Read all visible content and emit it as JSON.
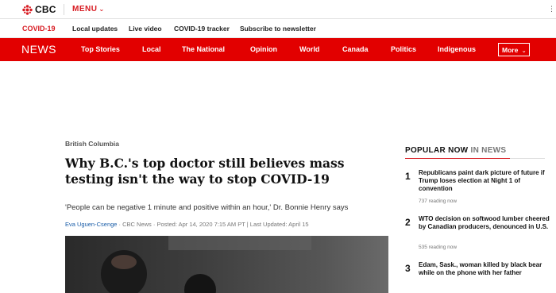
{
  "header": {
    "logo_text": "CBC",
    "menu_label": "MENU"
  },
  "covid_bar": {
    "label": "COVID-19",
    "links": [
      "Local updates",
      "Live video",
      "COVID-19 tracker",
      "Subscribe to newsletter"
    ]
  },
  "news_bar": {
    "brand": "NEWS",
    "nav": [
      "Top Stories",
      "Local",
      "The National",
      "Opinion",
      "World",
      "Canada",
      "Politics",
      "Indigenous"
    ],
    "more_label": "More"
  },
  "article": {
    "section": "British Columbia",
    "headline": "Why B.C.'s top doctor still believes mass testing isn't the way to stop COVID-19",
    "dek": "'People can be negative 1 minute and positive within an hour,' Dr. Bonnie Henry says",
    "author": "Eva Uguen-Csenge",
    "byline_rest": " · CBC News · Posted: Apr 14, 2020 7:15 AM PT | Last Updated: April 15"
  },
  "popular": {
    "title": "POPULAR NOW",
    "subtitle": " IN NEWS",
    "items": [
      {
        "num": "1",
        "title": "Republicans paint dark picture of future if Trump loses election at Night 1 of convention",
        "reading": "737 reading now"
      },
      {
        "num": "2",
        "title": "WTO decision on softwood lumber cheered by Canadian producers, denounced in U.S.",
        "reading": "535 reading now"
      },
      {
        "num": "3",
        "title": "Edam, Sask., woman killed by black bear while on the phone with her father",
        "reading": ""
      }
    ]
  },
  "colors": {
    "brand_red": "#e20000",
    "accent_red": "#d71920",
    "link_blue": "#1a5da8"
  }
}
